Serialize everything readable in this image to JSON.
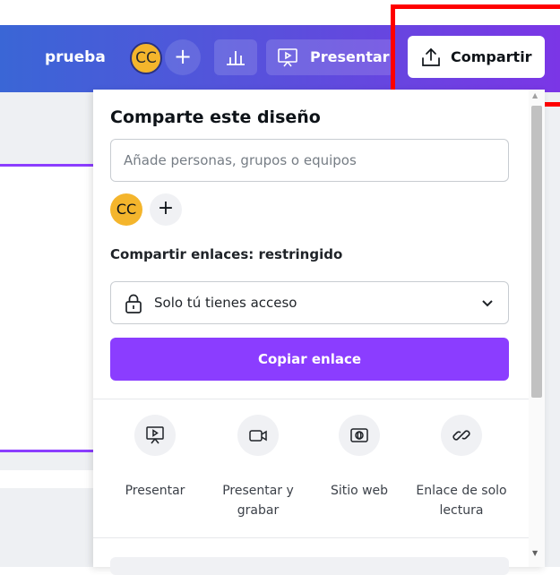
{
  "header": {
    "project_name": "prueba",
    "avatar_initials": "CC",
    "add_label": "+",
    "present_label": "Presentar",
    "share_label": "Compartir"
  },
  "panel": {
    "title": "Comparte este diseño",
    "people_placeholder": "Añade personas, grupos o equipos",
    "member_initials": "CC",
    "member_add": "+",
    "links_label": "Compartir enlaces: restringido",
    "access_value": "Solo tú tienes acceso",
    "copy_label": "Copiar enlace",
    "options": [
      {
        "label": "Presentar",
        "icon": "present-icon"
      },
      {
        "label": "Presentar y grabar",
        "icon": "video-camera-icon"
      },
      {
        "label": "Sitio web",
        "icon": "website-icon"
      },
      {
        "label": "Enlace de solo lectura",
        "icon": "link-icon"
      }
    ]
  },
  "colors": {
    "accent": "#8b3dff",
    "highlight": "#ff0000",
    "avatar": "#f4b52c"
  }
}
